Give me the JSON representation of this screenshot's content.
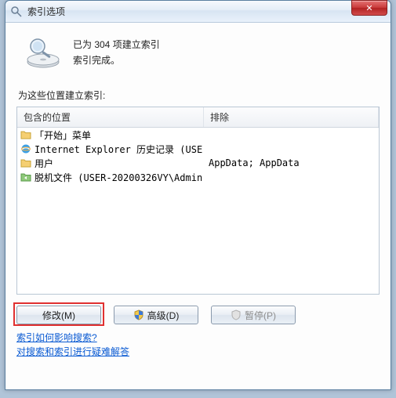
{
  "window": {
    "title": "索引选项",
    "close_label": "✕"
  },
  "status": {
    "line1": "已为 304 项建立索引",
    "line2": "索引完成。"
  },
  "section_label": "为这些位置建立索引:",
  "columns": {
    "location": "包含的位置",
    "exclude": "排除"
  },
  "rows": [
    {
      "icon": "folder",
      "location": "「开始」菜单",
      "exclude": ""
    },
    {
      "icon": "ie",
      "location": "Internet Explorer 历史记录 (USE...",
      "exclude": ""
    },
    {
      "icon": "folder",
      "location": "用户",
      "exclude": "AppData; AppData"
    },
    {
      "icon": "offline",
      "location": "脱机文件 (USER-20200326VY\\Admin...",
      "exclude": ""
    }
  ],
  "buttons": {
    "modify": "修改(M)",
    "advanced": "高级(D)",
    "pause": "暂停(P)"
  },
  "links": {
    "l1": "索引如何影响搜索?",
    "l2": "对搜索和索引进行疑难解答"
  }
}
